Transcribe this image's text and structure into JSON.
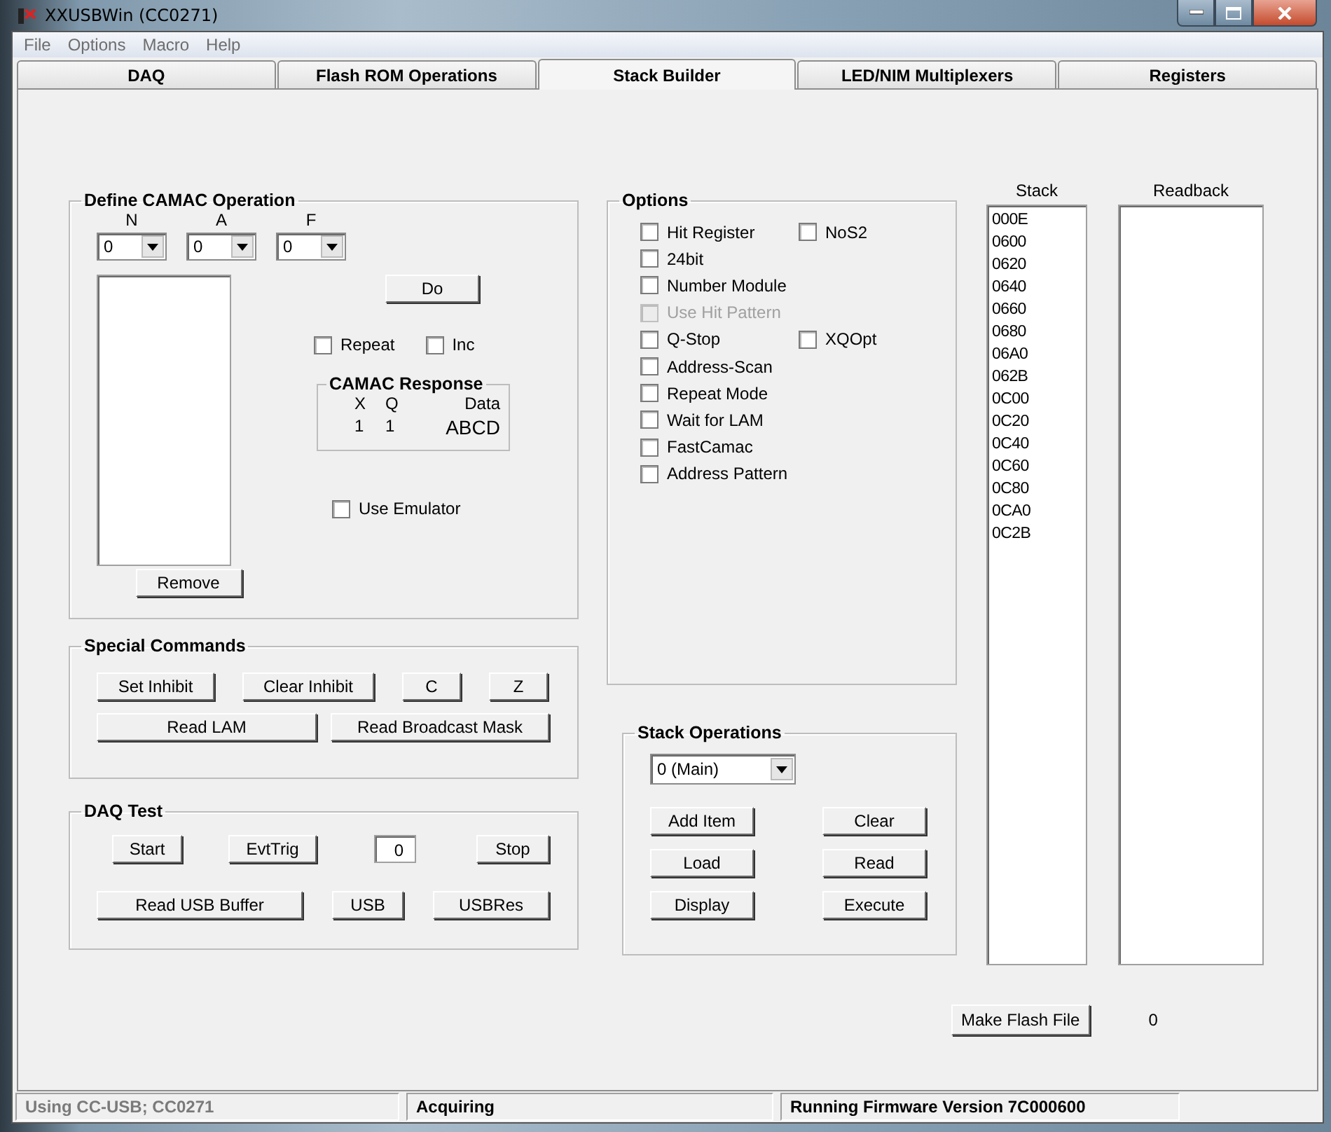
{
  "window": {
    "title": "XXUSBWin (CC0271)"
  },
  "menu": [
    "File",
    "Options",
    "Macro",
    "Help"
  ],
  "tabs": [
    {
      "label": "DAQ",
      "selected": false
    },
    {
      "label": "Flash ROM Operations",
      "selected": false
    },
    {
      "label": "Stack Builder",
      "selected": true
    },
    {
      "label": "LED/NIM Multiplexers",
      "selected": false
    },
    {
      "label": "Registers",
      "selected": false
    }
  ],
  "define_camac_operation": {
    "title": "Define CAMAC Operation",
    "selectors": [
      {
        "label": "N",
        "value": "0"
      },
      {
        "label": "A",
        "value": "0"
      },
      {
        "label": "F",
        "value": "0"
      }
    ],
    "do_button": "Do",
    "checkboxes": [
      {
        "label": "Repeat",
        "checked": false
      },
      {
        "label": "Inc",
        "checked": false
      }
    ],
    "response": {
      "title": "CAMAC Response",
      "headers": [
        "X",
        "Q",
        "Data"
      ],
      "values": [
        "1",
        "1",
        "ABCD"
      ]
    },
    "use_emulator": {
      "label": "Use Emulator",
      "checked": false
    },
    "remove_button": "Remove"
  },
  "special_commands": {
    "title": "Special Commands",
    "top_buttons": [
      "Set Inhibit",
      "Clear Inhibit",
      "C",
      "Z"
    ],
    "bottom_buttons": [
      "Read LAM",
      "Read Broadcast Mask"
    ]
  },
  "daq_test": {
    "title": "DAQ Test",
    "start_button": "Start",
    "evttrig_button": "EvtTrig",
    "counter": "0",
    "stop_button": "Stop",
    "bottom_buttons": [
      "Read USB Buffer",
      "USB",
      "USBRes"
    ]
  },
  "options": {
    "title": "Options",
    "rows": [
      [
        {
          "label": "Hit Register",
          "checked": false,
          "disabled": false
        },
        {
          "label": "NoS2",
          "checked": false,
          "disabled": false
        }
      ],
      [
        {
          "label": "24bit",
          "checked": false,
          "disabled": false
        }
      ],
      [
        {
          "label": "Number Module",
          "checked": false,
          "disabled": false
        }
      ],
      [
        {
          "label": "Use Hit Pattern",
          "checked": false,
          "disabled": true
        }
      ],
      [
        {
          "label": "Q-Stop",
          "checked": false,
          "disabled": false
        },
        {
          "label": "XQOpt",
          "checked": false,
          "disabled": false
        }
      ],
      [
        {
          "label": "Address-Scan",
          "checked": false,
          "disabled": false
        }
      ],
      [
        {
          "label": "Repeat Mode",
          "checked": false,
          "disabled": false
        }
      ],
      [
        {
          "label": "Wait for LAM",
          "checked": false,
          "disabled": false
        }
      ],
      [
        {
          "label": "FastCamac",
          "checked": false,
          "disabled": false
        }
      ],
      [
        {
          "label": "Address Pattern",
          "checked": false,
          "disabled": false
        }
      ]
    ]
  },
  "stack_operations": {
    "title": "Stack Operations",
    "stack_select": "0 (Main)",
    "buttons": [
      "Add Item",
      "Clear",
      "Load",
      "Read",
      "Display",
      "Execute"
    ]
  },
  "stack": {
    "label": "Stack",
    "items": [
      "000E",
      "0600",
      "0620",
      "0640",
      "0660",
      "0680",
      "06A0",
      "062B",
      "0C00",
      "0C20",
      "0C40",
      "0C60",
      "0C80",
      "0CA0",
      "0C2B"
    ]
  },
  "readback": {
    "label": "Readback"
  },
  "make_flash_file": {
    "button": "Make Flash File",
    "value": "0"
  },
  "status_bar": [
    {
      "text": "Using CC-USB; CC0271",
      "disabled": true
    },
    {
      "text": "Acquiring",
      "disabled": false
    },
    {
      "text": "Running Firmware Version 7C000600",
      "disabled": false
    }
  ]
}
